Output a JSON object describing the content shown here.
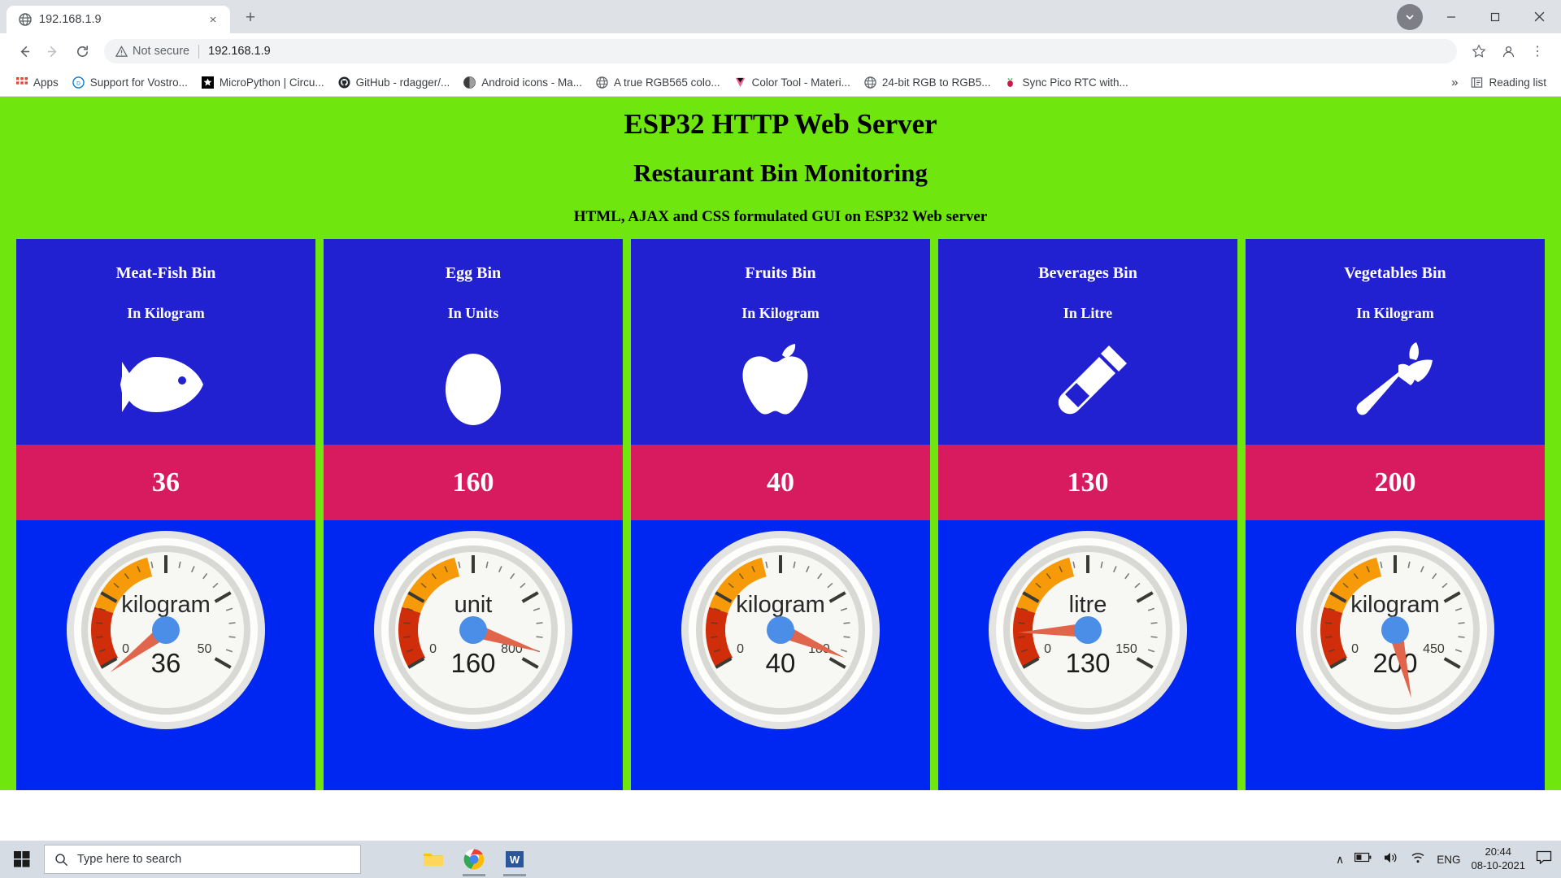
{
  "browser": {
    "tab": {
      "title": "192.168.1.9",
      "favicon": "globe-icon",
      "close": "×"
    },
    "new_tab_label": "+",
    "window_controls": {
      "minimize": "—",
      "maximize": "□",
      "close": "✕"
    },
    "toolbar": {
      "back": "←",
      "forward": "→",
      "reload": "⟳",
      "security_label": "Not secure",
      "url": "192.168.1.9",
      "bookmark_star": "☆",
      "menu": "⋮"
    },
    "bookmarks": {
      "apps_label": "Apps",
      "items": [
        {
          "label": "Support for Vostro...",
          "icon": "dell-icon"
        },
        {
          "label": "MicroPython | Circu...",
          "icon": "adafruit-icon"
        },
        {
          "label": "GitHub - rdagger/...",
          "icon": "github-icon"
        },
        {
          "label": "Android icons - Ma...",
          "icon": "material-icon"
        },
        {
          "label": "A true RGB565 colo...",
          "icon": "globe-icon"
        },
        {
          "label": "Color Tool - Materi...",
          "icon": "colortool-icon"
        },
        {
          "label": "24-bit RGB to RGB5...",
          "icon": "globe-icon"
        },
        {
          "label": "Sync Pico RTC with...",
          "icon": "raspberrypi-icon"
        }
      ],
      "overflow": "»",
      "reading_list": "Reading list"
    }
  },
  "page": {
    "title": "ESP32 HTTP Web Server",
    "subtitle": "Restaurant Bin Monitoring",
    "description": "HTML, AJAX and CSS formulated GUI on ESP32 Web server",
    "header_bg": "#6FE60E",
    "card_header_bg": "#2121D1",
    "card_value_bg": "#D81B5F",
    "card_gauge_bg": "#0026F2",
    "cards": [
      {
        "name": "Meat-Fish Bin",
        "unit_label": "In Kilogram",
        "icon": "fish-icon",
        "value": "36"
      },
      {
        "name": "Egg Bin",
        "unit_label": "In Units",
        "icon": "egg-icon",
        "value": "160"
      },
      {
        "name": "Fruits Bin",
        "unit_label": "In Kilogram",
        "icon": "apple-icon",
        "value": "40"
      },
      {
        "name": "Beverages Bin",
        "unit_label": "In Litre",
        "icon": "bottle-icon",
        "value": "130"
      },
      {
        "name": "Vegetables Bin",
        "unit_label": "In Kilogram",
        "icon": "carrot-icon",
        "value": "200"
      }
    ]
  },
  "chart_data": [
    {
      "type": "gauge",
      "title": "Meat-Fish Bin",
      "unit": "kilogram",
      "value": 36,
      "min": 0,
      "max": 50,
      "min_label": "0",
      "max_label": "50",
      "value_label": "36",
      "bands": [
        {
          "from": 0,
          "to": 10,
          "color": "#D02D0B"
        },
        {
          "from": 10,
          "to": 22,
          "color": "#F79A09"
        }
      ]
    },
    {
      "type": "gauge",
      "title": "Egg Bin",
      "unit": "unit",
      "value": 160,
      "min": 0,
      "max": 800,
      "min_label": "0",
      "max_label": "800",
      "value_label": "160",
      "bands": [
        {
          "from": 0,
          "to": 160,
          "color": "#D02D0B"
        },
        {
          "from": 160,
          "to": 352,
          "color": "#F79A09"
        }
      ]
    },
    {
      "type": "gauge",
      "title": "Fruits Bin",
      "unit": "kilogram",
      "value": 40,
      "min": 0,
      "max": 180,
      "min_label": "0",
      "max_label": "180",
      "value_label": "40",
      "bands": [
        {
          "from": 0,
          "to": 36,
          "color": "#D02D0B"
        },
        {
          "from": 36,
          "to": 79,
          "color": "#F79A09"
        }
      ]
    },
    {
      "type": "gauge",
      "title": "Beverages Bin",
      "unit": "litre",
      "value": 130,
      "min": 0,
      "max": 150,
      "min_label": "0",
      "max_label": "150",
      "value_label": "130",
      "bands": [
        {
          "from": 0,
          "to": 30,
          "color": "#D02D0B"
        },
        {
          "from": 30,
          "to": 66,
          "color": "#F79A09"
        }
      ]
    },
    {
      "type": "gauge",
      "title": "Vegetables Bin",
      "unit": "kilogram",
      "value": 200,
      "min": 0,
      "max": 450,
      "min_label": "0",
      "max_label": "450",
      "value_label": "200",
      "bands": [
        {
          "from": 0,
          "to": 90,
          "color": "#D02D0B"
        },
        {
          "from": 90,
          "to": 198,
          "color": "#F79A09"
        }
      ]
    }
  ],
  "taskbar": {
    "search_placeholder": "Type here to search",
    "apps": [
      "file-explorer-icon",
      "chrome-icon",
      "word-icon"
    ],
    "tray": {
      "chevron": "∧",
      "language": "ENG",
      "time": "20:44",
      "date": "08-10-2021"
    }
  }
}
